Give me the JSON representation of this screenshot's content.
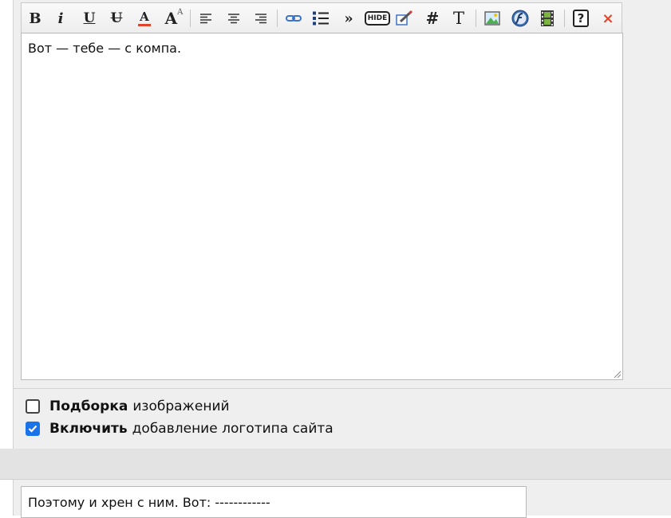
{
  "editor": {
    "content": "Вот — тебе — с компа.",
    "toolbar": [
      {
        "name": "bold-button",
        "glyph": "B",
        "style": "bold-serif"
      },
      {
        "name": "italic-button",
        "glyph": "i",
        "style": "italic-serif"
      },
      {
        "name": "underline-button",
        "glyph": "U",
        "style": "underline"
      },
      {
        "name": "strikethrough-button",
        "glyph": "U",
        "style": "strike"
      },
      {
        "name": "font-color-button",
        "glyph": "A",
        "style": "color"
      },
      {
        "name": "font-size-button",
        "glyph": "A",
        "style": "size"
      },
      {
        "name": "align-left-button",
        "icon": "align-left-icon"
      },
      {
        "name": "align-center-button",
        "icon": "align-center-icon"
      },
      {
        "name": "align-right-button",
        "icon": "align-right-icon"
      },
      {
        "name": "link-button",
        "icon": "link-icon"
      },
      {
        "name": "list-button",
        "icon": "list-icon"
      },
      {
        "name": "quote-button",
        "glyph": "»"
      },
      {
        "name": "hide-button",
        "glyph": "HIDE"
      },
      {
        "name": "edit-button",
        "icon": "edit-icon"
      },
      {
        "name": "hash-button",
        "glyph": "#"
      },
      {
        "name": "text-button",
        "glyph": "T"
      },
      {
        "name": "image-button",
        "icon": "image-icon"
      },
      {
        "name": "flash-button",
        "icon": "flash-icon"
      },
      {
        "name": "video-button",
        "icon": "film-icon"
      },
      {
        "name": "help-button",
        "glyph": "?"
      },
      {
        "name": "clear-button",
        "glyph": "×"
      }
    ],
    "colors": {
      "accent": "#1a73e8",
      "remove": "#e0442c",
      "link": "#3b73c9"
    }
  },
  "options": [
    {
      "bold": "Подборка",
      "rest": "изображений",
      "checked": false
    },
    {
      "bold": "Включить",
      "rest": "добавление логотипа сайта",
      "checked": true
    }
  ],
  "bottom_field": {
    "value": "Поэтому и хрен с ним. Вот: ------------"
  }
}
